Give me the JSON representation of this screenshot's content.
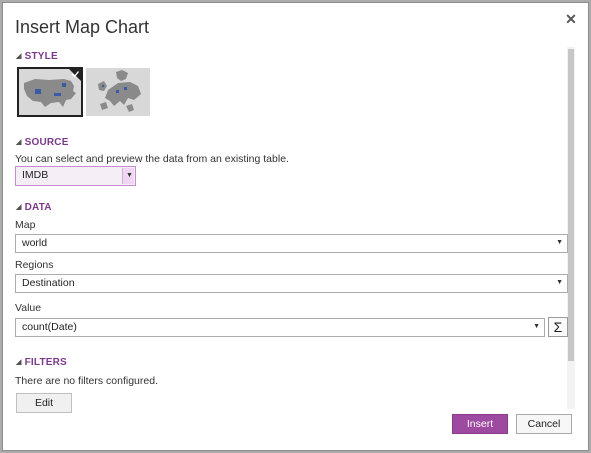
{
  "dialog": {
    "title": "Insert Map Chart",
    "close_glyph": "✕"
  },
  "style_section": {
    "header": "STYLE",
    "options": [
      {
        "name": "usa-map",
        "selected": true
      },
      {
        "name": "europe-map",
        "selected": false
      }
    ]
  },
  "source_section": {
    "header": "SOURCE",
    "description": "You can select and preview the data from an existing table.",
    "table_value": "IMDB"
  },
  "data_section": {
    "header": "DATA",
    "map_label": "Map",
    "map_value": "world",
    "regions_label": "Regions",
    "regions_value": "Destination",
    "value_label": "Value",
    "value_value": "count(Date)",
    "sigma_glyph": "Σ"
  },
  "filters_section": {
    "header": "FILTERS",
    "empty_text": "There are no filters configured.",
    "edit_label": "Edit"
  },
  "footer": {
    "insert_label": "Insert",
    "cancel_label": "Cancel"
  },
  "colors": {
    "accent": "#9e4aa0",
    "section_header": "#7a3a8a",
    "map_land": "#8a8a8a",
    "map_highlight": "#3a5ca8"
  }
}
